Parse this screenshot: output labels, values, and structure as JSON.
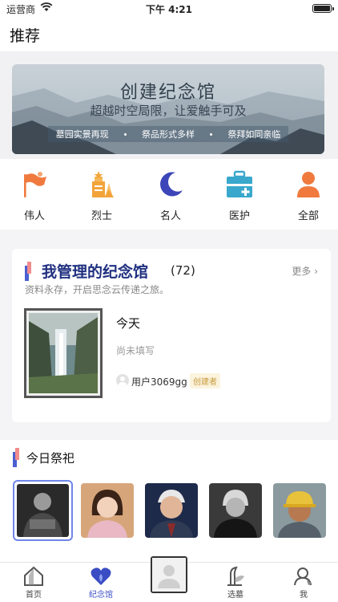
{
  "status_bar": {
    "carrier": "运营商",
    "time": "下午 4:21"
  },
  "header": {
    "title": "推荐"
  },
  "banner": {
    "title": "创建纪念馆",
    "subtitle": "超越时空局限，让爱触手可及",
    "tags": [
      "墓园实景再现",
      "祭品形式多样",
      "祭拜如同亲临"
    ]
  },
  "categories": [
    {
      "label": "伟人",
      "icon": "flag-icon",
      "color": "#f07a3e"
    },
    {
      "label": "烈士",
      "icon": "martyr-icon",
      "color": "#f2a43a"
    },
    {
      "label": "名人",
      "icon": "moon-star-icon",
      "color": "#3c46b8"
    },
    {
      "label": "医护",
      "icon": "medical-kit-icon",
      "color": "#3aa8cc"
    },
    {
      "label": "全部",
      "icon": "person-icon",
      "color": "#f07a3e"
    }
  ],
  "managed": {
    "heading": "我管理的纪念馆",
    "count": "(72)",
    "more_label": "更多 ›",
    "subtitle": "资料永存，开启思念云传递之旅。",
    "memorial": {
      "name": "今天",
      "description": "尚未填写",
      "user": "用户3069gg",
      "badge": "创建者"
    }
  },
  "today": {
    "heading": "今日祭祀"
  },
  "tabbar": {
    "items": [
      {
        "label": "首页",
        "icon": "home-icon"
      },
      {
        "label": "纪念馆",
        "icon": "heart-icon",
        "active": true
      },
      {
        "label": "选墓",
        "icon": "plant-icon"
      },
      {
        "label": "我",
        "icon": "user-icon"
      }
    ]
  },
  "colors": {
    "accent": "#3a4dc4",
    "orange": "#f07a3e",
    "selected_border": "#6f86e8"
  }
}
